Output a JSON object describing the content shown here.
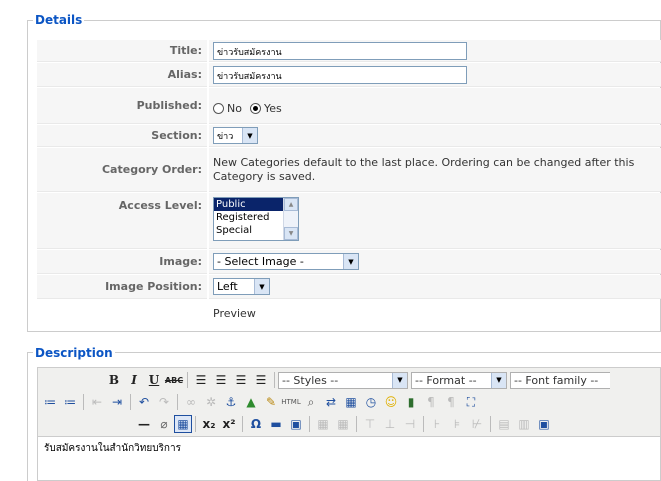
{
  "details": {
    "legend": "Details",
    "fields": {
      "title_label": "Title:",
      "title_value": "ข่าวรับสมัครงาน",
      "alias_label": "Alias:",
      "alias_value": "ข่าวรับสมัครงาน",
      "published_label": "Published:",
      "published_options": [
        "No",
        "Yes"
      ],
      "published_selected": "Yes",
      "section_label": "Section:",
      "section_value": "ข่าว",
      "category_order_label": "Category Order:",
      "category_order_text": "New Categories default to the last place. Ordering can be changed after this Category is saved.",
      "access_label": "Access Level:",
      "access_options": [
        "Public",
        "Registered",
        "Special"
      ],
      "access_selected": "Public",
      "image_label": "Image:",
      "image_value": "- Select Image -",
      "image_position_label": "Image Position:",
      "image_position_value": "Left",
      "preview_text": "Preview"
    }
  },
  "description": {
    "legend": "Description",
    "toolbar": {
      "styles": "-- Styles --",
      "format": "-- Format --",
      "font_family": "-- Font family --"
    },
    "content": "รับสมัครงานในสำนักวิทยบริการ"
  },
  "icons": [
    "bold-icon",
    "italic-icon",
    "underline-icon",
    "strikethrough-icon",
    "align-left-icon",
    "align-center-icon",
    "align-right-icon",
    "align-justify-icon",
    "bullet-list-icon",
    "numbered-list-icon",
    "outdent-icon",
    "indent-icon",
    "undo-icon",
    "redo-icon",
    "link-icon",
    "unlink-icon",
    "anchor-icon",
    "image-icon",
    "cleanup-icon",
    "html-icon",
    "find-icon",
    "replace-icon",
    "insert-date-icon",
    "insert-time-icon",
    "emoticon-icon",
    "media-icon",
    "ltr-icon",
    "rtl-icon",
    "fullscreen-icon",
    "horizontal-rule-icon",
    "remove-format-icon",
    "visual-aid-icon",
    "subscript-icon",
    "superscript-icon",
    "special-char-icon",
    "advanced-hr-icon",
    "edit-icon",
    "table-icon"
  ]
}
